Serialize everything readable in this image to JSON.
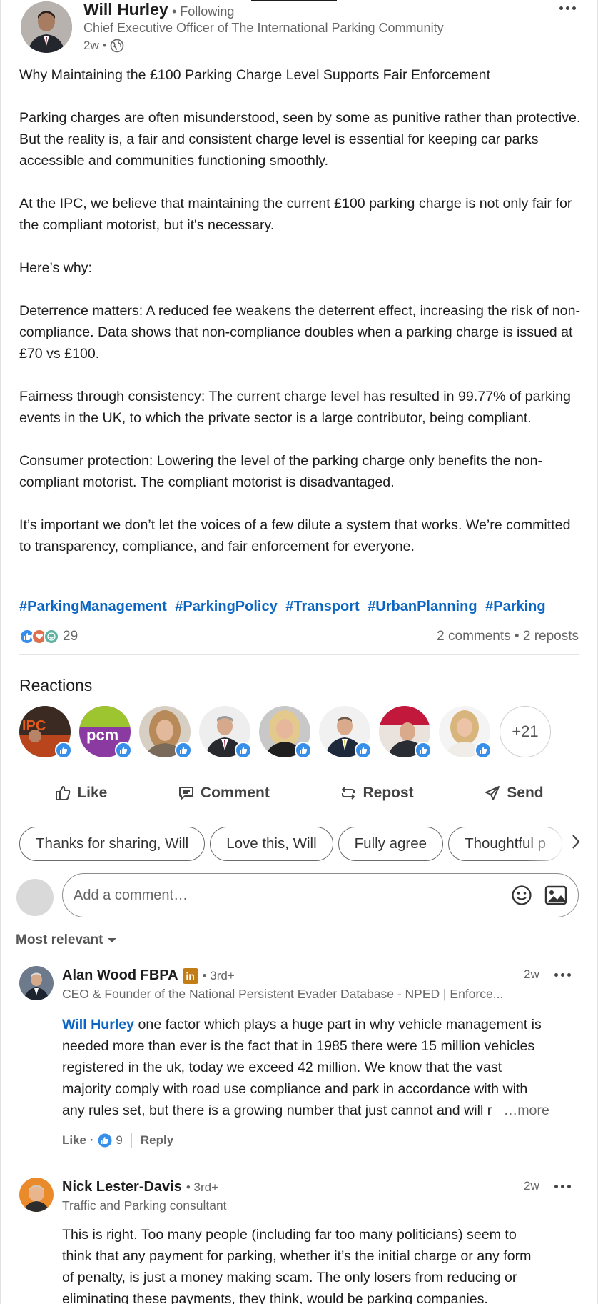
{
  "post": {
    "author_name": "Will Hurley",
    "follow_status": "• Following",
    "author_title": "Chief Executive Officer of The International Parking Community",
    "age": "2w •",
    "paragraphs": [
      "Why Maintaining the £100 Parking Charge Level Supports Fair Enforcement",
      "",
      "Parking charges are often misunderstood, seen by some as punitive rather than protective. But the reality is, a fair and consistent charge level is essential for keeping car parks accessible and communities functioning smoothly.",
      "",
      "At the IPC, we believe that maintaining the current £100 parking charge is not only fair for the compliant motorist, but it's necessary.",
      "",
      "Here’s why:",
      "",
      "Deterrence matters: A reduced fee weakens the deterrent effect, increasing the risk of non-compliance. Data shows that non-compliance doubles when a parking charge is issued at £70 vs £100.",
      "",
      "Fairness through consistency: The current charge level has resulted in 99.77% of parking events in the UK, to which the private sector is a large contributor, being compliant.",
      "",
      "Consumer protection: Lowering the level of the parking charge only benefits the non-compliant motorist. The compliant motorist is disadvantaged.",
      "",
      "It’s important we don’t let the voices of a few dilute a system that works. We’re committed to transparency, compliance, and fair enforcement for everyone."
    ],
    "hashtags": [
      "#ParkingManagement",
      "#ParkingPolicy",
      "#Transport",
      "#UrbanPlanning",
      "#Parking"
    ],
    "reaction_count": "29",
    "comments_reposts": "2 comments • 2 reposts"
  },
  "reactions": {
    "title": "Reactions",
    "more_count": "+21"
  },
  "actions": {
    "like": "Like",
    "comment": "Comment",
    "repost": "Repost",
    "send": "Send"
  },
  "suggestions": [
    "Thanks for sharing, Will",
    "Love this, Will",
    "Fully agree",
    "Thoughtful p"
  ],
  "comment_box": {
    "placeholder": "Add a comment…"
  },
  "sort_label": "Most relevant",
  "comments": [
    {
      "name": "Alan Wood FBPA",
      "badge": "in",
      "degree": "• 3rd+",
      "headline": "CEO & Founder of the National Persistent Evader Database - NPED | Enforce...",
      "age": "2w",
      "mention": "Will Hurley",
      "text_lines": [
        " one factor which plays a huge part in why vehicle management is",
        "needed more than ever is the fact that in 1985 there were 15 million vehicles",
        "registered in the uk, today we exceed 42 million. We know that the vast",
        "majority comply with road use compliance and park in accordance with with",
        "any rules set, but there is a growing number that just cannot and will r"
      ],
      "more": "…more",
      "like_label": "Like ·",
      "like_count": "9",
      "reply_label": "Reply"
    },
    {
      "name": "Nick Lester-Davis",
      "degree": "• 3rd+",
      "headline": "Traffic and Parking consultant",
      "age": "2w",
      "text_lines": [
        "This is right. Too many people (including far too many politicians) seem to",
        "think that any payment for parking, whether it’s the initial charge or any form",
        "of penalty, is just a money making scam. The only losers from reducing or",
        "eliminating these payments, they think, would be parking companies."
      ]
    }
  ],
  "colors": {
    "link": "#0a66c2",
    "like_blue": "#378fe9",
    "muted": "#666666"
  }
}
